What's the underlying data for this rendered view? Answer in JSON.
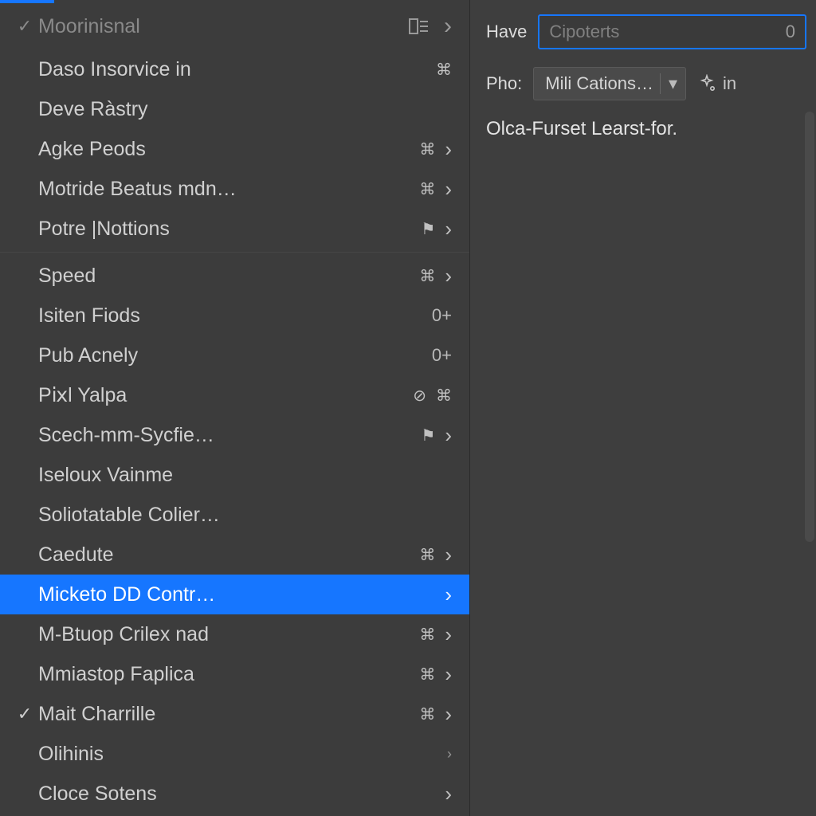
{
  "colors": {
    "accent": "#1676ff",
    "bg": "#3c3c3c",
    "text": "#d0d0d0"
  },
  "left": {
    "header": {
      "label": "Moorinisnal",
      "checked": true
    },
    "groups": [
      {
        "items": [
          {
            "label": "Daso Insorvice in",
            "icons": [
              "keys"
            ],
            "chev": false
          },
          {
            "label": "Deve Ràstry"
          },
          {
            "label": "Agke Peods",
            "icons": [
              "keys"
            ],
            "chev": true
          },
          {
            "label": "Motride Beatus mdn…",
            "icons": [
              "keys"
            ],
            "chev": true
          },
          {
            "label": "Potre |Nottions",
            "icons": [
              "flag"
            ],
            "chev": true
          }
        ]
      },
      {
        "items": [
          {
            "label": "Speed",
            "icons": [
              "keys"
            ],
            "chev": true
          },
          {
            "label": "Isiten Fiods",
            "hint": "0+"
          },
          {
            "label": "Pub Acnely",
            "hint": "0+"
          },
          {
            "label": "Pⅸl Yalpa",
            "icons": [
              "check-circle",
              "keys"
            ]
          },
          {
            "label": "Scech-mm-Sycfie…",
            "icons": [
              "flag"
            ],
            "chev": true
          },
          {
            "label": "Iseloux Vainme"
          },
          {
            "label": "Soliotatable Colier…"
          },
          {
            "label": "Caedute",
            "icons": [
              "keys"
            ],
            "chev": true
          },
          {
            "label": "Micketo DD Contr…",
            "selected": true,
            "chev": true
          },
          {
            "label": "M-Btuop Crilex nad",
            "icons": [
              "keys"
            ],
            "chev": true
          },
          {
            "label": "Mmiastop Faplica",
            "icons": [
              "keys"
            ],
            "chev": true
          },
          {
            "label": "Mait Charrille",
            "checked": true,
            "icons": [
              "keys"
            ],
            "chev": true
          },
          {
            "label": "Olihinis",
            "chev": true,
            "tiny": true
          },
          {
            "label": "Cloce Sotens",
            "chev": true
          }
        ]
      }
    ]
  },
  "right": {
    "row1": {
      "label": "Have",
      "placeholder": "Cipoterts",
      "suffix": "0"
    },
    "row2": {
      "label": "Pho:",
      "select_value": "Mili Cations…",
      "tool_text": "in"
    },
    "body": "Olca-Furset Learst-for."
  }
}
